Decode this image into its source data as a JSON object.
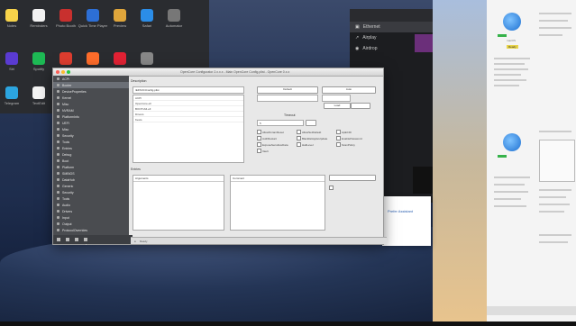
{
  "launchpad": {
    "row1": [
      {
        "label": "Notes",
        "color": "#f7d34a"
      },
      {
        "label": "Reminders",
        "color": "#f2f2f2"
      },
      {
        "label": "Photo Booth",
        "color": "#c8302e"
      },
      {
        "label": "Quick Time Player",
        "color": "#2d6fd6"
      },
      {
        "label": "Preview",
        "color": "#e0a63b"
      },
      {
        "label": "Safari",
        "color": "#2b8de8"
      },
      {
        "label": "Automator",
        "color": "#777777"
      }
    ],
    "row2": [
      {
        "label": "Siri",
        "color": "#5a3bd1"
      },
      {
        "label": "Spotify",
        "color": "#1db954"
      },
      {
        "label": "Chrome",
        "color": "#de3d2f"
      },
      {
        "label": "Firefox",
        "color": "#ff6d2b"
      },
      {
        "label": "Opera",
        "color": "#e22234"
      },
      {
        "label": "Utilities",
        "color": "#888888"
      }
    ],
    "row3": [
      {
        "label": "Telegram",
        "color": "#2ca5e0"
      },
      {
        "label": "TextEdit",
        "color": "#f4f4f4"
      }
    ]
  },
  "darkpanel": {
    "items": [
      "Ethernet",
      "Airplay",
      "Airdrop"
    ]
  },
  "window": {
    "title": "OpenCore Configurator 2.x.x.x - Main OpenCore Config.plist - OpenCore 0.x.x",
    "sidebar": [
      "ACPI",
      "Booter",
      "DeviceProperties",
      "Kernel",
      "Misc",
      "NVRAM",
      "PlatformInfo",
      "UEFI",
      "Misc",
      "Security",
      "Tools",
      "Entries",
      "Debug",
      "Boot",
      "Platform",
      "SMBIOS",
      "DataHub",
      "Generic",
      "Security",
      "Tools",
      "Audio",
      "Drivers",
      "Input",
      "Output",
      "ProtocolOverrides",
      "Quirks",
      "ReservedMemory"
    ],
    "section_top": "Description",
    "section_bottom": "Entries",
    "field_path": "\\EFI\\OC\\Config.plist",
    "dropdown_one": "Default",
    "dropdown_two": "Auto",
    "blue_button": "Load",
    "timeout_label": "Timeout",
    "timeout_value": "5",
    "checks": [
      "AllowNvramReset",
      "AllowSetDefault",
      "ApECID",
      "AuthRestart",
      "BlacklistAppleUpdate",
      "EnablePassword",
      "ExposeSensitiveData",
      "HaltLevel",
      "ScanPolicy",
      "Vault"
    ],
    "list_top": [
      "ACPI",
      "OpenCore.efi",
      "BOOTx64.efi",
      "Drivers",
      "Kexts"
    ],
    "col_arguments": "Arguments",
    "col_comment": "Comment",
    "status_text": "Ready"
  },
  "popup": {
    "text": "Prefer Assistant"
  },
  "rightdoc": {
    "title": "macOS",
    "badge": "Ready"
  }
}
